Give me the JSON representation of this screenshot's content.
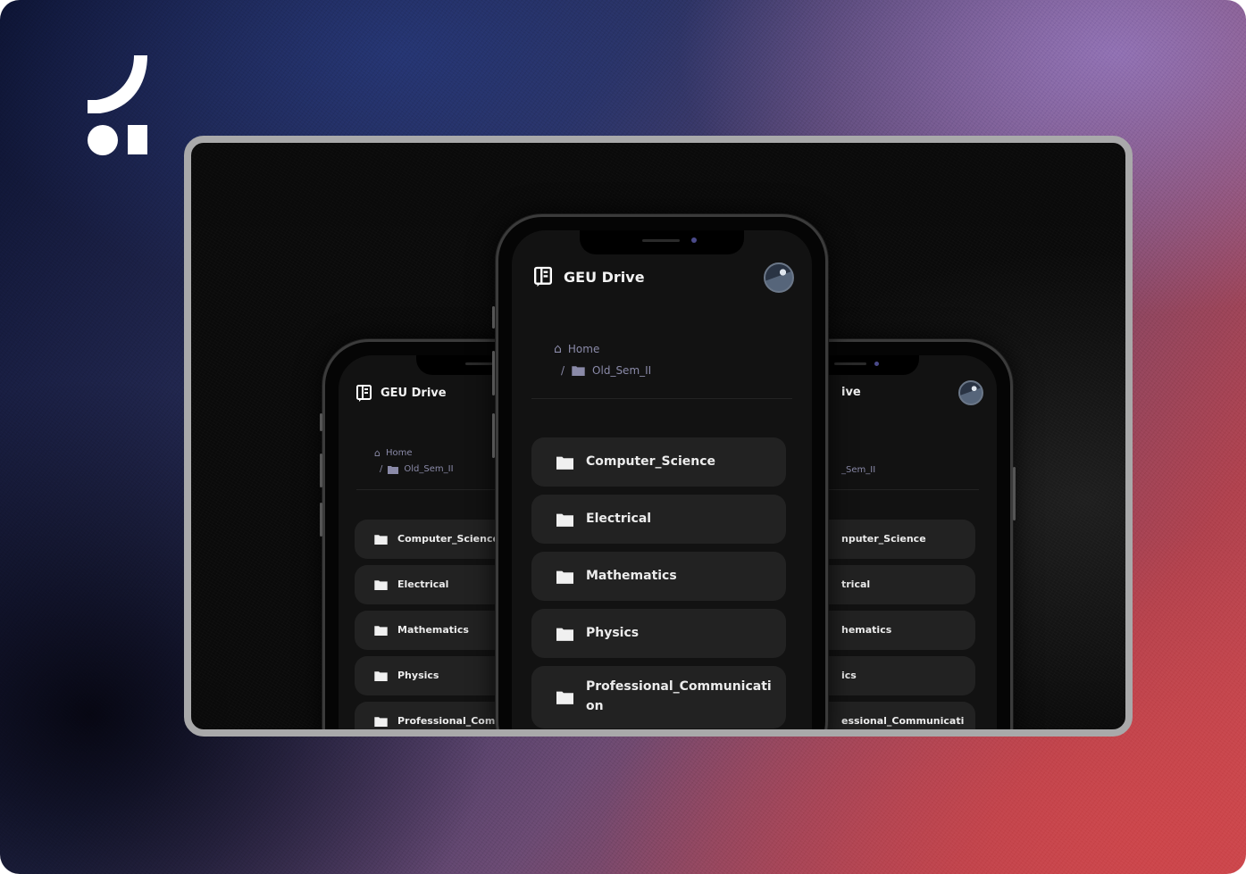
{
  "brand": {
    "logo_icon": "brand-logo-icon"
  },
  "app": {
    "title": "GEU Drive",
    "logo_icon": "notebook-icon",
    "avatar_icon": "theme-toggle-avatar"
  },
  "breadcrumb": {
    "home_label": "Home",
    "home_icon": "home-icon",
    "separator": "/",
    "current_label": "Old_Sem_II",
    "current_icon": "folder-icon"
  },
  "folders": [
    {
      "label": "Computer_Science",
      "icon": "folder-icon"
    },
    {
      "label": "Electrical",
      "icon": "folder-icon"
    },
    {
      "label": "Mathematics",
      "icon": "folder-icon"
    },
    {
      "label": "Physics",
      "icon": "folder-icon"
    },
    {
      "label": "Professional_Communication",
      "icon": "folder-icon",
      "display": "Professional_Communicati on"
    }
  ],
  "left_phone": {
    "folders_visible": [
      "Computer_Science",
      "Electrical",
      "Mathematics",
      "Physics",
      "Professional_Comm"
    ]
  },
  "right_phone": {
    "title_visible": "ive",
    "crumb_visible": "_Sem_II",
    "folders_visible": [
      "nputer_Science",
      "trical",
      "hematics",
      "ics",
      "essional_Communicati"
    ]
  },
  "colors": {
    "screen_bg": "#121212",
    "card_bg": "#222222",
    "breadcrumb": "#8a8aa8",
    "frame_border": "#a9a9aa"
  }
}
